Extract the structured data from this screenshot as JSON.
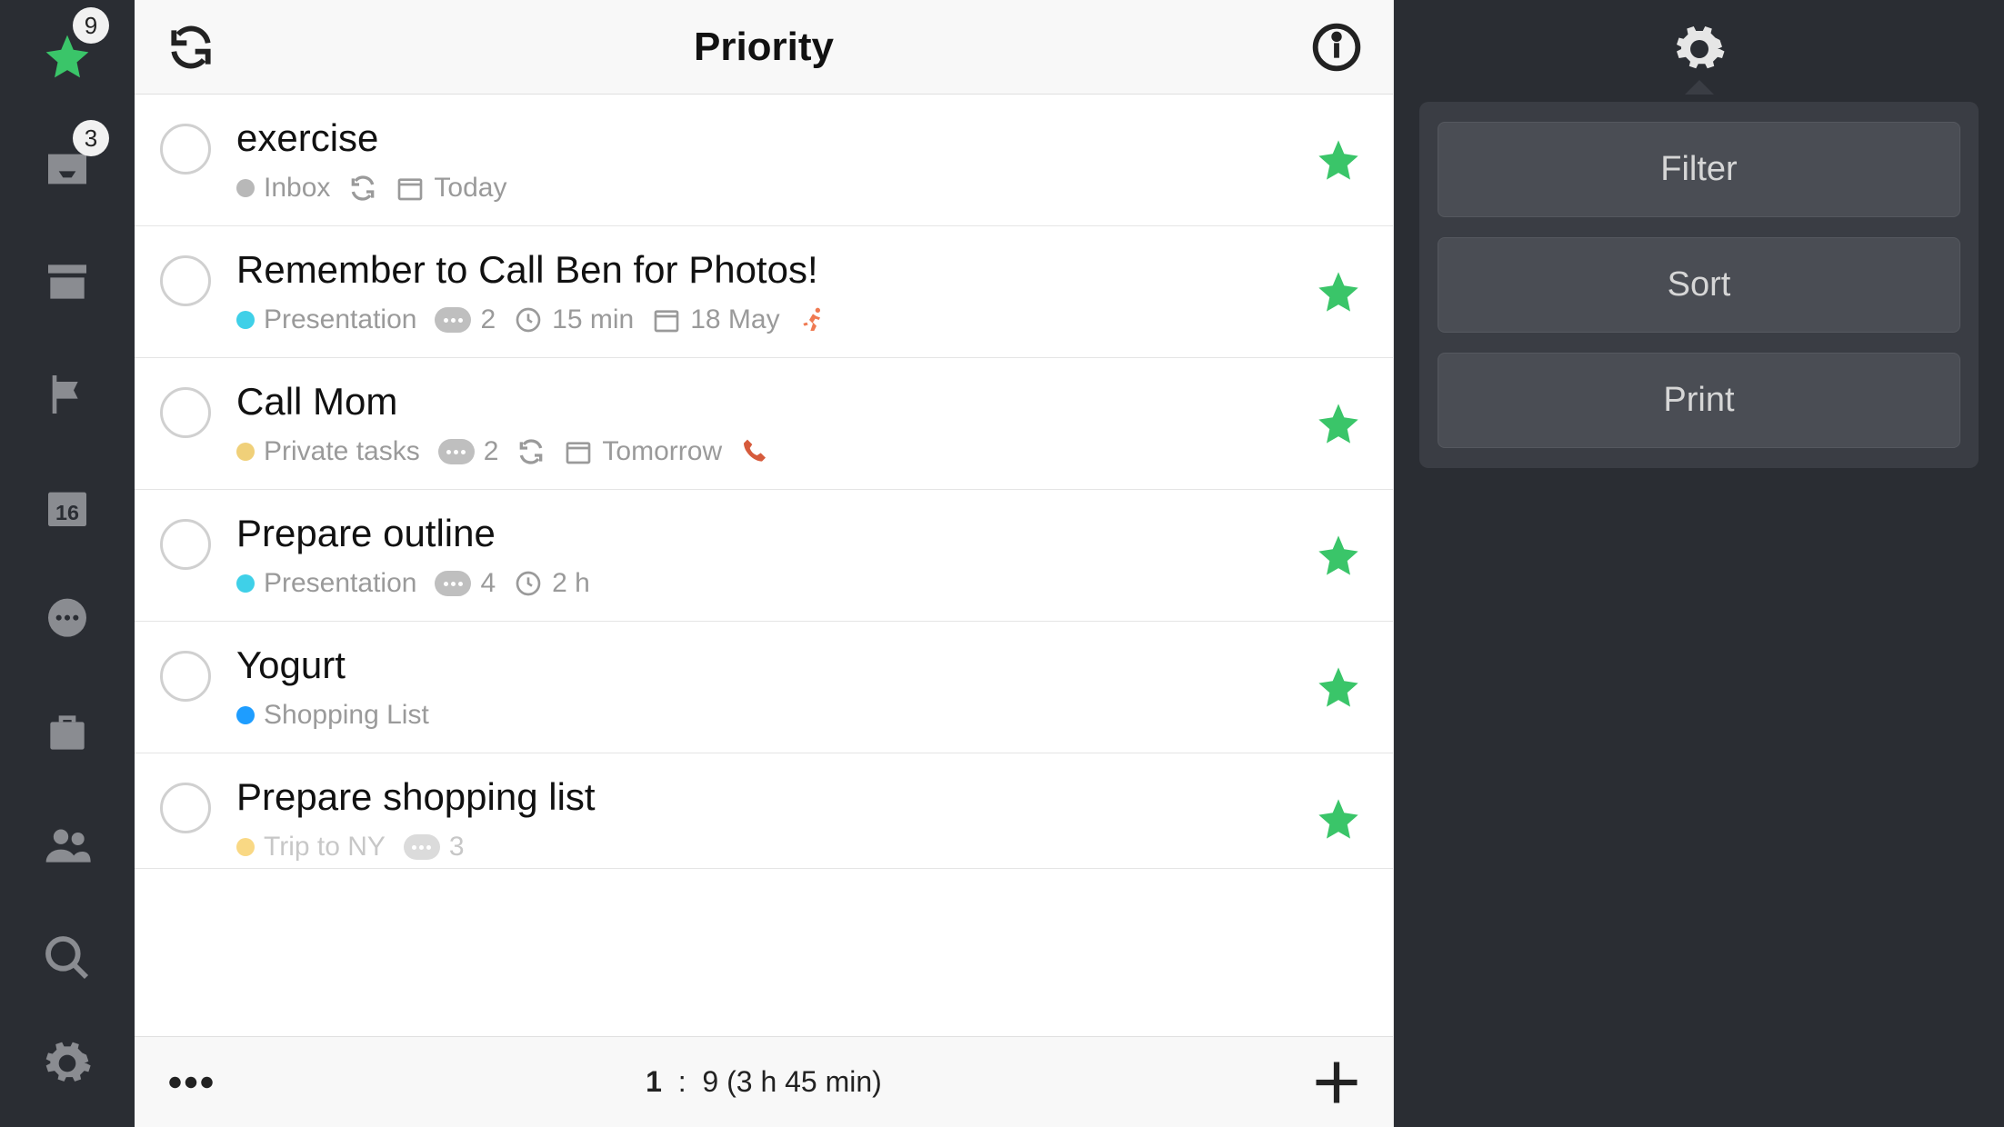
{
  "header": {
    "title": "Priority"
  },
  "sidebar": {
    "items": [
      {
        "name": "priority-star",
        "badge": "9"
      },
      {
        "name": "inbox",
        "badge": "3"
      },
      {
        "name": "archive"
      },
      {
        "name": "flag"
      },
      {
        "name": "calendar",
        "dayLabel": "16"
      },
      {
        "name": "chat"
      },
      {
        "name": "suitcase"
      },
      {
        "name": "people"
      },
      {
        "name": "search"
      },
      {
        "name": "settings"
      }
    ]
  },
  "tasks": [
    {
      "title": "exercise",
      "list": "Inbox",
      "listColor": "#b8b8b8",
      "repeat": true,
      "date": "Today"
    },
    {
      "title": "Remember to Call Ben for Photos!",
      "list": "Presentation",
      "listColor": "#3fd0e8",
      "comments": "2",
      "duration": "15 min",
      "date": "18 May",
      "context": "running"
    },
    {
      "title": "Call Mom",
      "list": "Private tasks",
      "listColor": "#f0d079",
      "comments": "2",
      "repeat": true,
      "date": "Tomorrow",
      "context": "phone"
    },
    {
      "title": "Prepare outline",
      "list": "Presentation",
      "listColor": "#3fd0e8",
      "comments": "4",
      "duration": "2 h"
    },
    {
      "title": "Yogurt",
      "list": "Shopping List",
      "listColor": "#1e9dff"
    },
    {
      "title": "Prepare shopping list",
      "list": "Trip to NY",
      "listColor": "#f5b921",
      "comments": "3"
    }
  ],
  "footer": {
    "position": "1",
    "sep": ":",
    "total": "9 (3 h 45 min)"
  },
  "rightPanel": {
    "buttons": [
      {
        "label": "Filter"
      },
      {
        "label": "Sort"
      },
      {
        "label": "Print"
      }
    ]
  }
}
